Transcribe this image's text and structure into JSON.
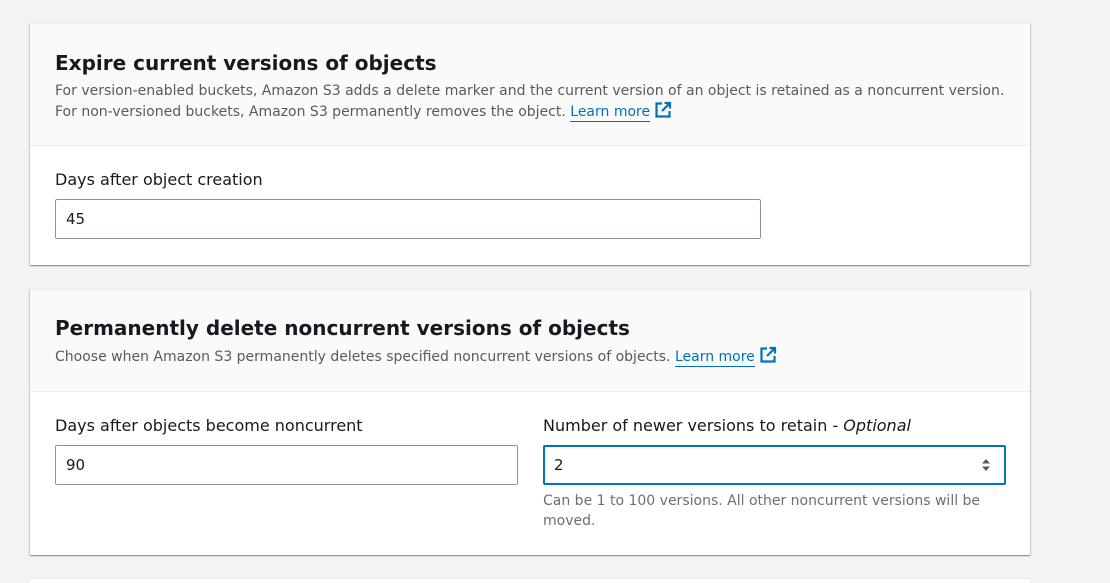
{
  "expire_current": {
    "title": "Expire current versions of objects",
    "description": "For version-enabled buckets, Amazon S3 adds a delete marker and the current version of an object is retained as a noncurrent version. For non-versioned buckets, Amazon S3 permanently removes the object.",
    "learn_more": "Learn more",
    "days_label": "Days after object creation",
    "days_value": "45"
  },
  "delete_noncurrent": {
    "title": "Permanently delete noncurrent versions of objects",
    "description": "Choose when Amazon S3 permanently deletes specified noncurrent versions of objects.",
    "learn_more": "Learn more",
    "days_label": "Days after objects become noncurrent",
    "days_value": "90",
    "versions_label": "Number of newer versions to retain - ",
    "versions_label_optional": "Optional",
    "versions_value": "2",
    "versions_hint": "Can be 1 to 100 versions. All other noncurrent versions will be moved."
  },
  "icons": {
    "external_link": "external-link-icon",
    "spinner": "number-spinner-icon"
  },
  "colors": {
    "link": "#0073bb",
    "focus_border": "#0073bb",
    "text": "#16191f",
    "secondary_text": "#545b64"
  }
}
